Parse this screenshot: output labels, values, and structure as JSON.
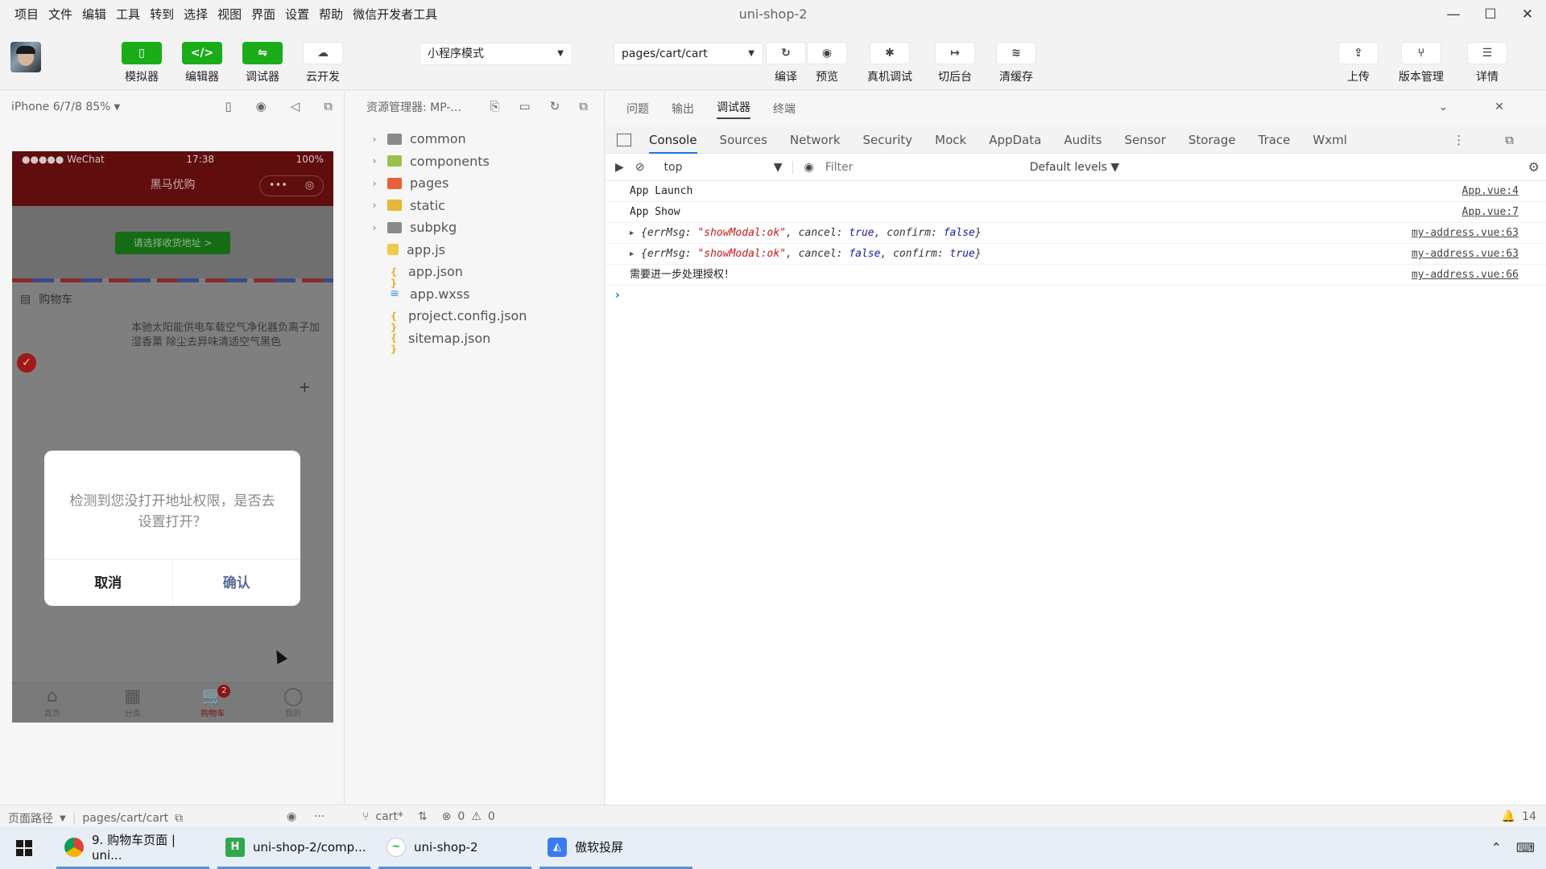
{
  "menubar": {
    "items": [
      "项目",
      "文件",
      "编辑",
      "工具",
      "转到",
      "选择",
      "视图",
      "界面",
      "设置",
      "帮助",
      "微信开发者工具"
    ],
    "title": "uni-shop-2"
  },
  "toolbar": {
    "simulator": "模拟器",
    "editor": "编辑器",
    "debugger": "调试器",
    "cloud": "云开发",
    "mode_select": "小程序模式",
    "page_select": "pages/cart/cart",
    "compile": "编译",
    "preview": "预览",
    "device_debug": "真机调试",
    "background": "切后台",
    "clear_cache": "清缓存",
    "upload": "上传",
    "version": "版本管理",
    "details": "详情"
  },
  "simulator": {
    "device": "iPhone 6/7/8 85%",
    "status_carrier": "●●●●● WeChat",
    "status_time": "17:38",
    "status_battery": "100%",
    "nav_title": "黑马优购",
    "nav_more": "•••",
    "address_button": "请选择收货地址 >",
    "cart_header": "购物车",
    "goods_title": "本驰太阳能供电车载空气净化器负离子加湿香薰 除尘去异味清适空气黑色",
    "modal_message": "检测到您没打开地址权限，是否去设置打开？",
    "modal_cancel": "取消",
    "modal_confirm": "确认",
    "tabs": [
      {
        "label": "首页",
        "icon": "⌂"
      },
      {
        "label": "分类",
        "icon": "▦"
      },
      {
        "label": "购物车",
        "icon": "🛒",
        "badge": "2"
      },
      {
        "label": "我的",
        "icon": "◯"
      }
    ]
  },
  "explorer": {
    "title": "资源管理器: MP-...",
    "items": [
      {
        "name": "common",
        "type": "folder",
        "icon": "folder"
      },
      {
        "name": "components",
        "type": "folder",
        "icon": "components"
      },
      {
        "name": "pages",
        "type": "folder",
        "icon": "pages"
      },
      {
        "name": "static",
        "type": "folder",
        "icon": "static"
      },
      {
        "name": "subpkg",
        "type": "folder",
        "icon": "folder"
      },
      {
        "name": "app.js",
        "type": "file",
        "icon": "js"
      },
      {
        "name": "app.json",
        "type": "file",
        "icon": "json"
      },
      {
        "name": "app.wxss",
        "type": "file",
        "icon": "wxss"
      },
      {
        "name": "project.config.json",
        "type": "file",
        "icon": "json"
      },
      {
        "name": "sitemap.json",
        "type": "file",
        "icon": "json"
      }
    ]
  },
  "debug": {
    "panel_tabs": [
      "问题",
      "输出",
      "调试器",
      "终端"
    ],
    "devtools_tabs": [
      "Console",
      "Sources",
      "Network",
      "Security",
      "Mock",
      "AppData",
      "Audits",
      "Sensor",
      "Storage",
      "Trace",
      "Wxml"
    ],
    "context": "top",
    "filter_placeholder": "Filter",
    "levels": "Default levels ▼",
    "logs": [
      {
        "text": "App Launch",
        "src": "App.vue:4"
      },
      {
        "text": "App Show",
        "src": "App.vue:7"
      },
      {
        "src": "my-address.vue:63",
        "cancel": "true",
        "confirm": "false"
      },
      {
        "src": "my-address.vue:63",
        "cancel": "false",
        "confirm": "true"
      },
      {
        "text": "需要进一步处理授权！",
        "src": "my-address.vue:66"
      }
    ],
    "obj_prefix": "{errMsg: ",
    "obj_msg": "\"showModal:ok\"",
    "obj_cancel_key": ", cancel: ",
    "obj_confirm_key": ", confirm: ",
    "obj_suffix": "}"
  },
  "statusbar": {
    "path_label": "页面路径",
    "path": "pages/cart/cart",
    "branch": "cart*",
    "errors": "0",
    "warnings": "0",
    "notifications": "14"
  },
  "taskbar": {
    "items": [
      "9. 购物车页面 | uni...",
      "uni-shop-2/comp...",
      "uni-shop-2",
      "傲软投屏"
    ]
  }
}
